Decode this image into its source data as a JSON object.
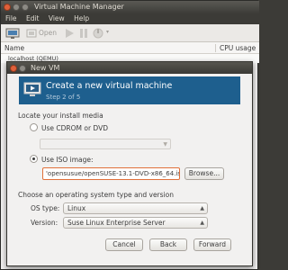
{
  "app": {
    "title": "Virtual Machine Manager"
  },
  "menu": [
    "File",
    "Edit",
    "View",
    "Help"
  ],
  "toolbar": {
    "open_label": "Open"
  },
  "list": {
    "col_name": "Name",
    "col_cpu": "CPU usage",
    "rows": [
      "localhost (QEMU)"
    ]
  },
  "dialog": {
    "title": "New VM",
    "banner_title": "Create a new virtual machine",
    "banner_step": "Step 2 of 5",
    "locate_heading": "Locate your install media",
    "cdrom_label": "Use CDROM or DVD",
    "iso_label": "Use ISO image:",
    "iso_value": "'opensusue/openSUSE-13.1-DVD-x86_64.iso",
    "browse_label": "Browse...",
    "os_heading": "Choose an operating system type and version",
    "os_type_label": "OS type:",
    "os_type_value": "Linux",
    "version_label": "Version:",
    "version_value": "Suse Linux Enterprise Server",
    "cancel_label": "Cancel",
    "back_label": "Back",
    "forward_label": "Forward",
    "selected_media": "iso"
  },
  "colors": {
    "banner": "#1e5f8e",
    "close_button": "#e0603a",
    "focus_border": "#e0703a"
  }
}
